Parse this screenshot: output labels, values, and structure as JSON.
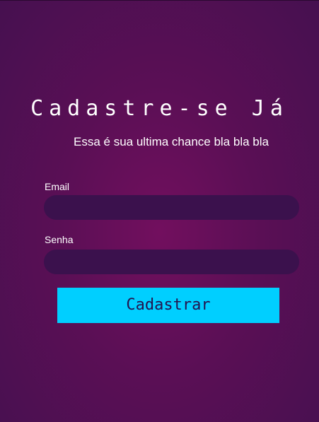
{
  "header": {
    "title": "Cadastre-se Já",
    "subtitle": "Essa é sua ultima chance bla bla bla"
  },
  "form": {
    "email": {
      "label": "Email",
      "value": "",
      "placeholder": ""
    },
    "senha": {
      "label": "Senha",
      "value": "",
      "placeholder": ""
    },
    "submit_label": "Cadastrar"
  },
  "colors": {
    "background": "#5a0f55",
    "input_background": "#3b114d",
    "button": "#00cfff",
    "button_text": "#24144f"
  }
}
